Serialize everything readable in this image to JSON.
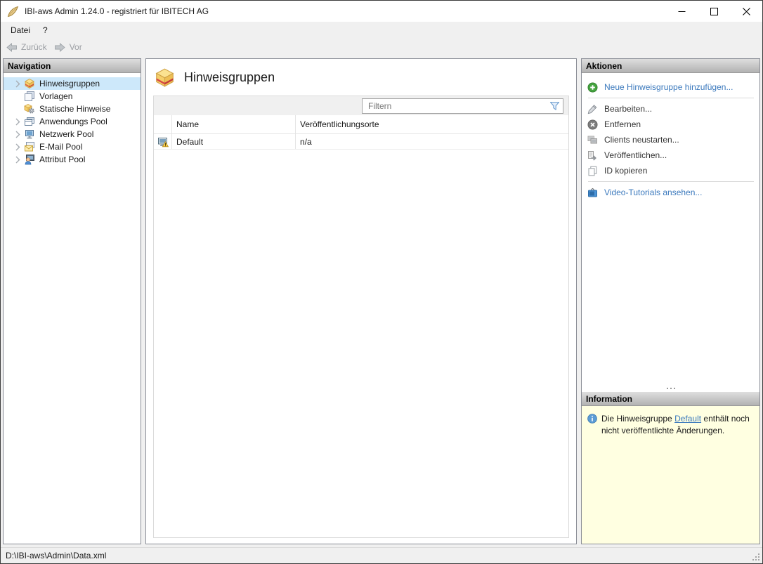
{
  "window": {
    "title": "IBI-aws Admin 1.24.0 - registriert für IBITECH AG"
  },
  "menu": {
    "items": [
      {
        "label": "Datei"
      },
      {
        "label": "?"
      }
    ]
  },
  "toolbar": {
    "back_label": "Zurück",
    "forward_label": "Vor"
  },
  "navigation": {
    "header": "Navigation",
    "items": [
      {
        "label": "Hinweisgruppen",
        "icon": "notice-group-icon",
        "selected": true,
        "expandable": true
      },
      {
        "label": "Vorlagen",
        "icon": "templates-icon",
        "selected": false,
        "expandable": false
      },
      {
        "label": "Statische Hinweise",
        "icon": "static-notices-icon",
        "selected": false,
        "expandable": false
      },
      {
        "label": "Anwendungs Pool",
        "icon": "application-pool-icon",
        "selected": false,
        "expandable": true
      },
      {
        "label": "Netzwerk Pool",
        "icon": "network-pool-icon",
        "selected": false,
        "expandable": true
      },
      {
        "label": "E-Mail Pool",
        "icon": "email-pool-icon",
        "selected": false,
        "expandable": true
      },
      {
        "label": "Attribut Pool",
        "icon": "attribute-pool-icon",
        "selected": false,
        "expandable": true
      }
    ]
  },
  "main": {
    "title": "Hinweisgruppen",
    "filter": {
      "placeholder": "Filtern"
    },
    "table": {
      "columns": [
        "Name",
        "Veröffentlichungsorte"
      ],
      "rows": [
        {
          "name": "Default",
          "locations": "n/a"
        }
      ]
    }
  },
  "actions": {
    "header": "Aktionen",
    "items": [
      {
        "label": "Neue Hinweisgruppe hinzufügen...",
        "icon": "add-icon",
        "style": "link"
      },
      {
        "label": "Bearbeiten...",
        "icon": "edit-icon",
        "style": "normal"
      },
      {
        "label": "Entfernen",
        "icon": "remove-icon",
        "style": "normal"
      },
      {
        "label": "Clients neustarten...",
        "icon": "restart-clients-icon",
        "style": "normal"
      },
      {
        "label": "Veröffentlichen...",
        "icon": "publish-icon",
        "style": "normal"
      },
      {
        "label": "ID kopieren",
        "icon": "copy-id-icon",
        "style": "normal"
      },
      {
        "label": "Video-Tutorials ansehen...",
        "icon": "video-tutorials-icon",
        "style": "link"
      }
    ]
  },
  "information": {
    "header": "Information",
    "message_before": "Die Hinweisgruppe ",
    "link_text": "Default",
    "message_after": " enthält noch nicht veröffentlichte Änderungen."
  },
  "statusbar": {
    "path": "D:\\IBI-aws\\Admin\\Data.xml"
  },
  "colors": {
    "link_blue": "#3b79bd",
    "selection_blue": "#cde8fa",
    "info_background": "#ffffe1",
    "header_gradient_top": "#dedede",
    "header_gradient_bottom": "#b2b2b2"
  }
}
